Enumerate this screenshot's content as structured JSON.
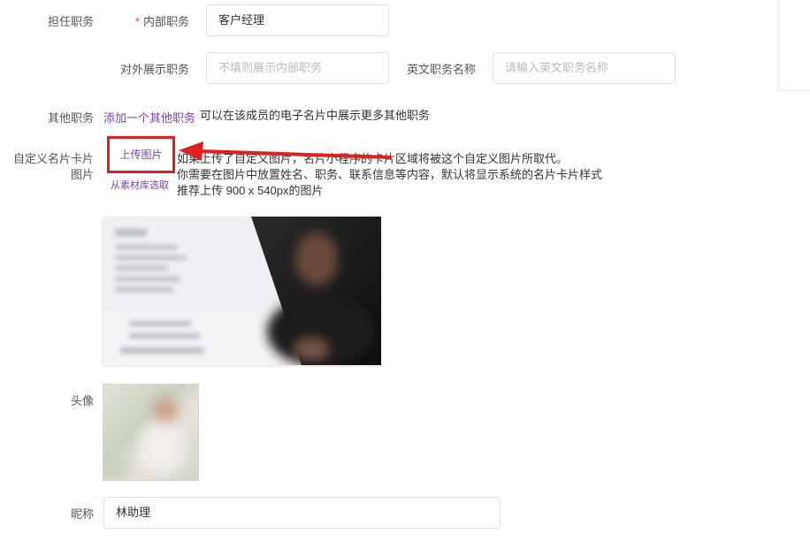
{
  "form": {
    "position_label": "担任职务",
    "internal_position": {
      "label": "内部职务",
      "required_mark": "*",
      "value": "客户经理"
    },
    "external_position": {
      "label": "对外展示职务",
      "placeholder": "不填则展示内部职务"
    },
    "english_position": {
      "label": "英文职务名称",
      "placeholder": "请输入英文职务名称"
    },
    "other_positions": {
      "label": "其他职务",
      "add_link": "添加一个其他职务",
      "hint": "可以在该成员的电子名片中展示更多其他职务"
    },
    "custom_card_image": {
      "label_line1": "自定义名片卡片",
      "label_line2": "图片",
      "upload_button": "上传图片",
      "library_link": "从素材库选取",
      "hint_line1": "如果上传了自定义图片，名片小程序的卡片区域将被这个自定义图片所取代。",
      "hint_line2": "你需要在图片中放置姓名、职务、联系信息等内容，默认将显示系统的名片卡片样式",
      "hint_line3": "推荐上传 900 x 540px的图片"
    },
    "avatar": {
      "label": "头像"
    },
    "nickname": {
      "label": "昵称",
      "value": "林助理"
    }
  },
  "colors": {
    "accent": "#7b3fb6",
    "highlight": "#e0201e",
    "required": "#e4393c"
  },
  "icons": {
    "arrow": "red-arrow-annotation",
    "card_preview": "business-card-image-icon",
    "avatar_preview": "avatar-image-icon"
  }
}
